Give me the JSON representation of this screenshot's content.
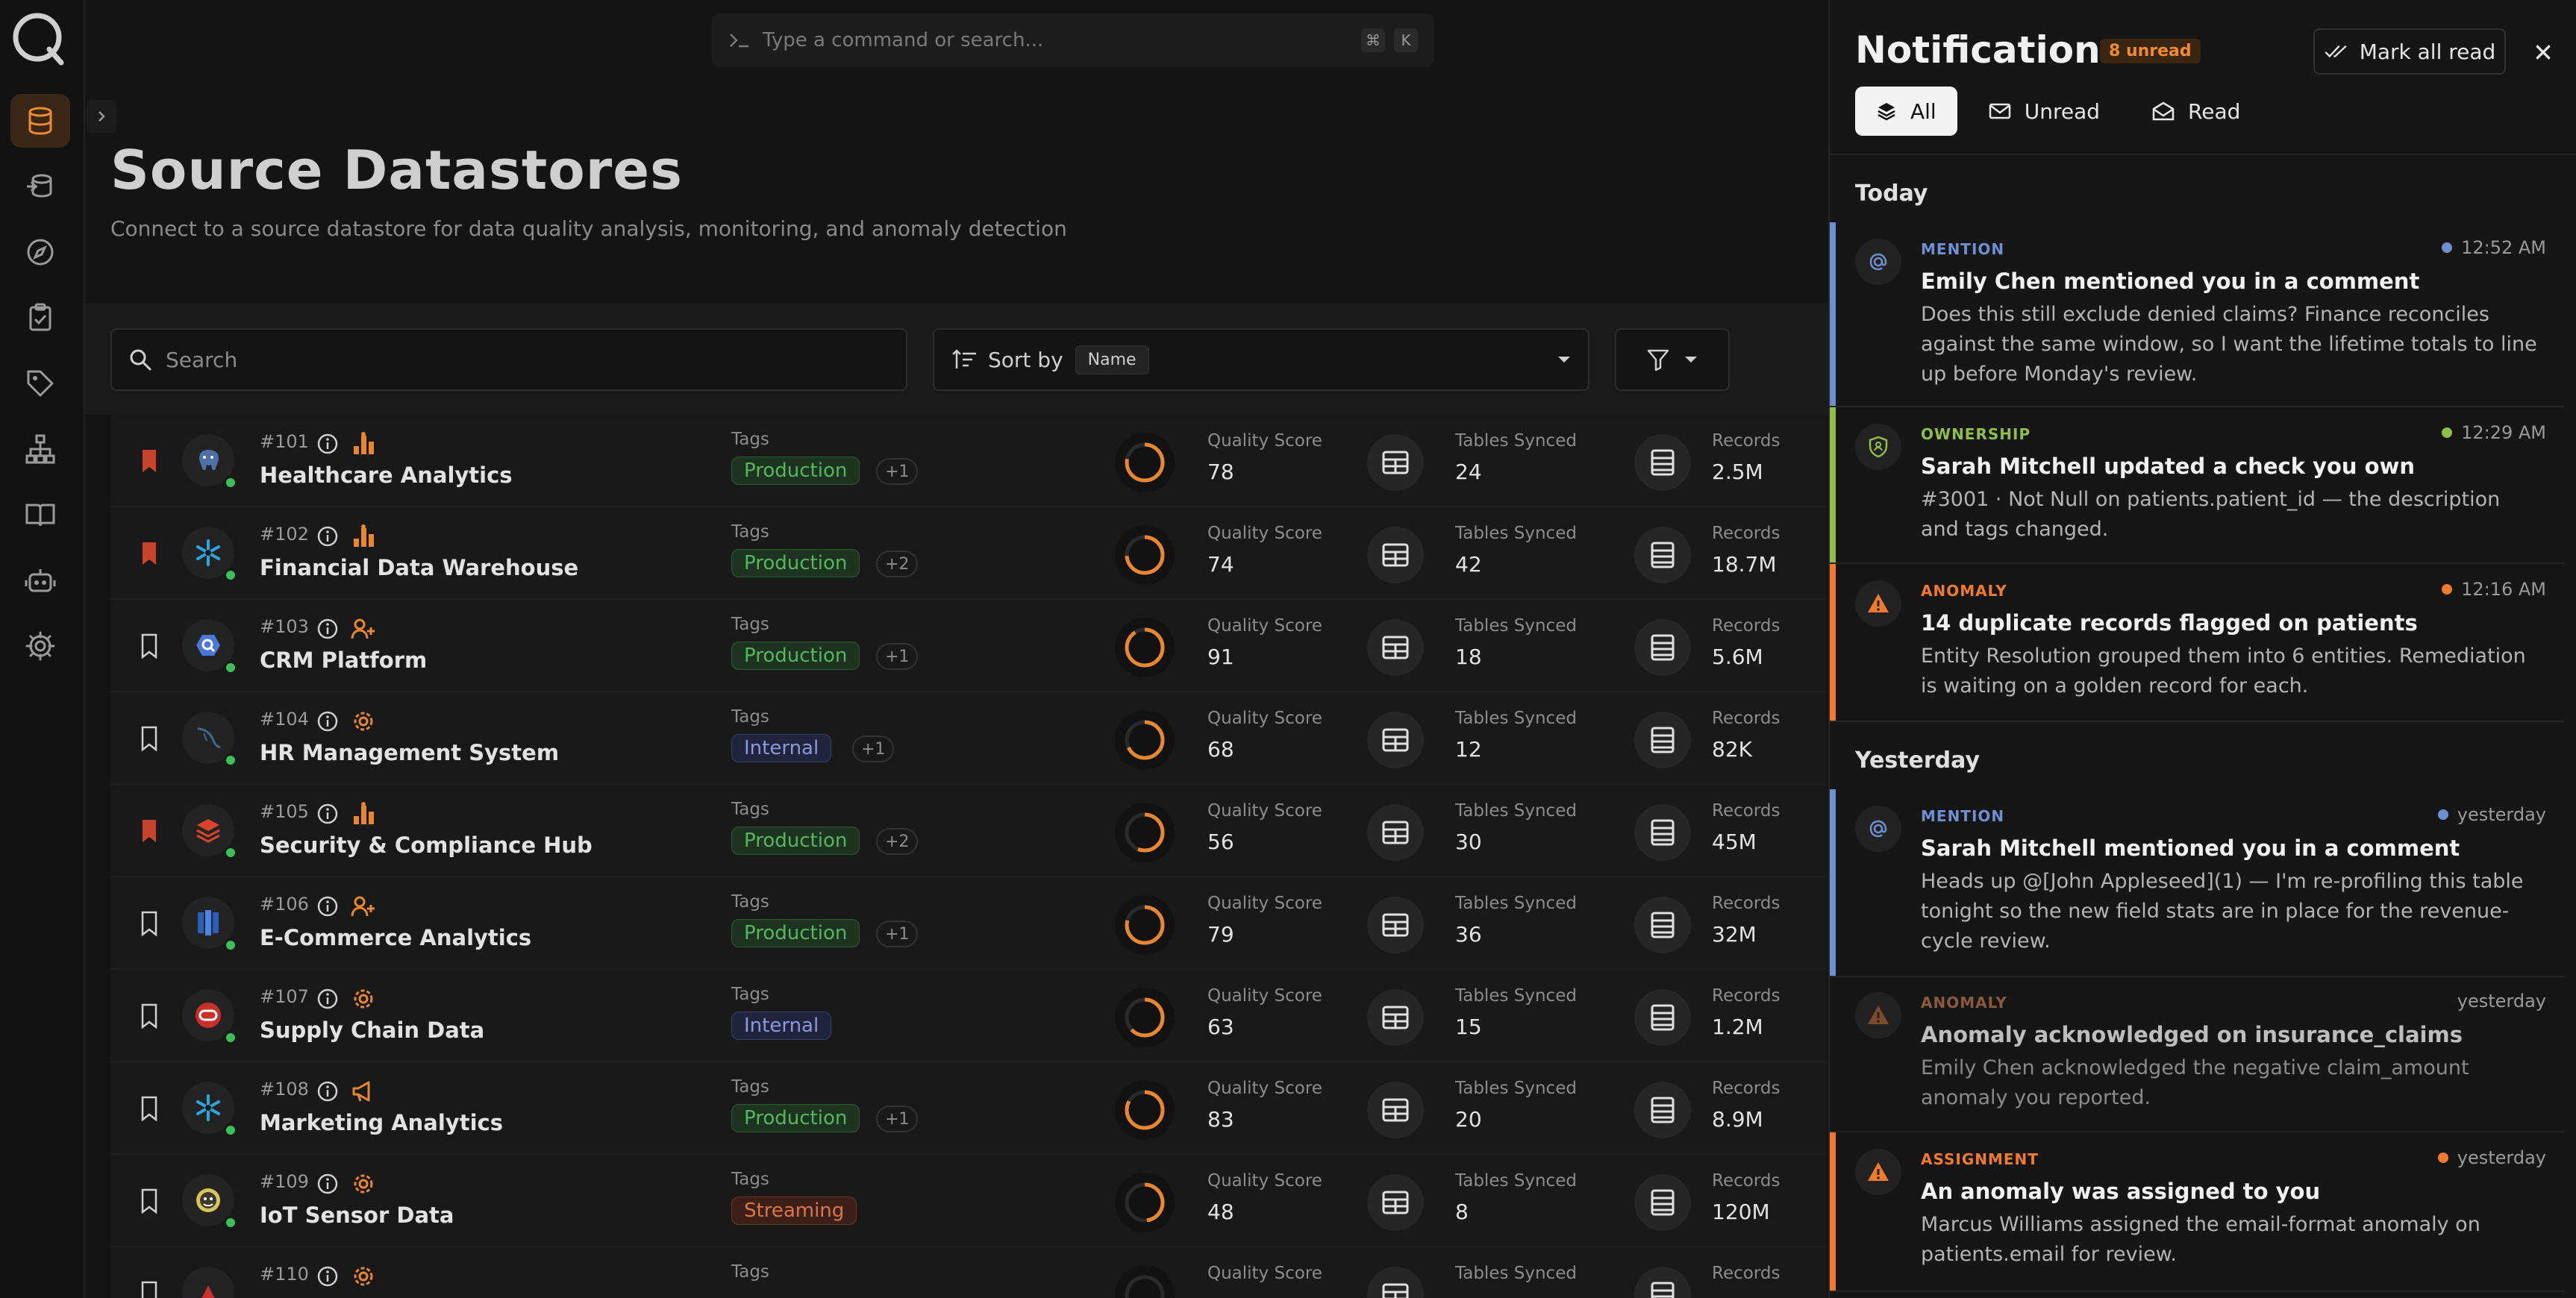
{
  "command_bar": {
    "placeholder": "Type a command or search...",
    "key_1": "⌘",
    "key_2": "K"
  },
  "page": {
    "title": "Source Datastores",
    "subtitle": "Connect to a source datastore for data quality analysis, monitoring, and anomaly detection"
  },
  "toolbar": {
    "search_placeholder": "Search",
    "sort_label": "Sort by",
    "sort_value": "Name"
  },
  "labels": {
    "tags": "Tags",
    "quality": "Quality Score",
    "tables": "Tables Synced",
    "records": "Records"
  },
  "datastores": [
    {
      "id": "#101",
      "name": "Healthcare Analytics",
      "tag": "Production",
      "tag_style": "production",
      "more": "+1",
      "quality": "78",
      "tables": "24",
      "records": "2.5M",
      "bookmarked": true,
      "type_icon": "chart-icon",
      "db_icon": "postgres-icon"
    },
    {
      "id": "#102",
      "name": "Financial Data Warehouse",
      "tag": "Production",
      "tag_style": "production",
      "more": "+2",
      "quality": "74",
      "tables": "42",
      "records": "18.7M",
      "bookmarked": true,
      "type_icon": "chart-icon",
      "db_icon": "snowflake-icon"
    },
    {
      "id": "#103",
      "name": "CRM Platform",
      "tag": "Production",
      "tag_style": "production",
      "more": "+1",
      "quality": "91",
      "tables": "18",
      "records": "5.6M",
      "bookmarked": false,
      "type_icon": "people-icon",
      "db_icon": "bigquery-icon"
    },
    {
      "id": "#104",
      "name": "HR Management System",
      "tag": "Internal",
      "tag_style": "internal",
      "more": "+1",
      "quality": "68",
      "tables": "12",
      "records": "82K",
      "bookmarked": false,
      "type_icon": "gear-icon",
      "db_icon": "mysql-icon"
    },
    {
      "id": "#105",
      "name": "Security & Compliance Hub",
      "tag": "Production",
      "tag_style": "production",
      "more": "+2",
      "quality": "56",
      "tables": "30",
      "records": "45M",
      "bookmarked": true,
      "type_icon": "chart-icon",
      "db_icon": "databricks-icon"
    },
    {
      "id": "#106",
      "name": "E-Commerce Analytics",
      "tag": "Production",
      "tag_style": "production",
      "more": "+1",
      "quality": "79",
      "tables": "36",
      "records": "32M",
      "bookmarked": false,
      "type_icon": "people-icon",
      "db_icon": "redshift-icon"
    },
    {
      "id": "#107",
      "name": "Supply Chain Data",
      "tag": "Internal",
      "tag_style": "internal",
      "more": "",
      "quality": "63",
      "tables": "15",
      "records": "1.2M",
      "bookmarked": false,
      "type_icon": "gear-icon",
      "db_icon": "oracle-icon"
    },
    {
      "id": "#108",
      "name": "Marketing Analytics",
      "tag": "Production",
      "tag_style": "production",
      "more": "+1",
      "quality": "83",
      "tables": "20",
      "records": "8.9M",
      "bookmarked": false,
      "type_icon": "megaphone-icon",
      "db_icon": "snowflake-icon"
    },
    {
      "id": "#109",
      "name": "IoT Sensor Data",
      "tag": "Streaming",
      "tag_style": "streaming",
      "more": "",
      "quality": "48",
      "tables": "8",
      "records": "120M",
      "bookmarked": false,
      "type_icon": "gear-icon",
      "db_icon": "hive-icon"
    },
    {
      "id": "#110",
      "name": "",
      "tag": "",
      "tag_style": "production",
      "more": "",
      "quality": "",
      "tables": "",
      "records": "",
      "bookmarked": false,
      "type_icon": "gear-icon",
      "db_icon": "generic-icon"
    }
  ],
  "notifications": {
    "title": "Notifications",
    "unread_badge": "8 unread",
    "mark_all": "Mark all read",
    "tabs": [
      "All",
      "Unread",
      "Read"
    ],
    "groups": [
      "Today",
      "Yesterday"
    ],
    "items": [
      {
        "category": "MENTION",
        "color": "#6e8fd1",
        "time": "12:52 AM",
        "title": "Emily Chen mentioned you in a comment",
        "body": "Does this still exclude denied claims? Finance reconciles against the same window, so I want the lifetime totals to line up before Monday's review.",
        "read": false,
        "icon": "at-icon"
      },
      {
        "category": "OWNERSHIP",
        "color": "#8fbf4a",
        "time": "12:29 AM",
        "title": "Sarah Mitchell updated a check you own",
        "body": "#3001 · Not Null on patients.patient_id — the description and tags changed.",
        "read": false,
        "icon": "shield-icon"
      },
      {
        "category": "ANOMALY",
        "color": "#f07a2e",
        "time": "12:16 AM",
        "title": "14 duplicate records flagged on patients",
        "body": "Entity Resolution grouped them into 6 entities. Remediation is waiting on a golden record for each.",
        "read": false,
        "icon": "warning-icon"
      },
      {
        "category": "MENTION",
        "color": "#6e8fd1",
        "time": "yesterday",
        "title": "Sarah Mitchell mentioned you in a comment",
        "body": "Heads up @[John Appleseed](1) — I'm re-profiling this table tonight so the new field stats are in place for the revenue-cycle review.",
        "read": false,
        "icon": "at-icon"
      },
      {
        "category": "ANOMALY",
        "color": "#f07a2e",
        "time": "yesterday",
        "title": "Anomaly acknowledged on insurance_claims",
        "body": "Emily Chen acknowledged the negative claim_amount anomaly you reported.",
        "read": true,
        "icon": "warning-icon"
      },
      {
        "category": "ASSIGNMENT",
        "color": "#f07a2e",
        "time": "yesterday",
        "title": "An anomaly was assigned to you",
        "body": "Marcus Williams assigned the email-format anomaly on patients.email for review.",
        "read": false,
        "icon": "warning-icon"
      }
    ]
  }
}
